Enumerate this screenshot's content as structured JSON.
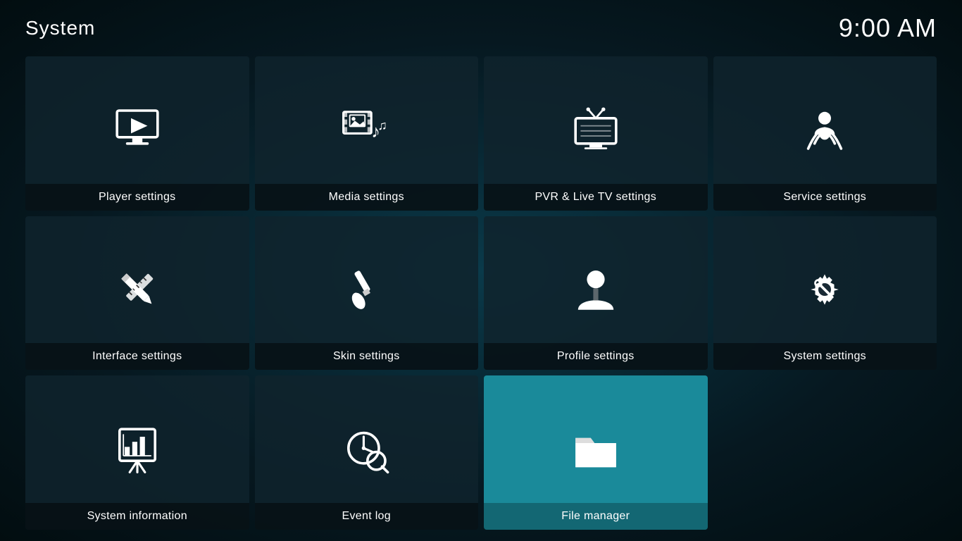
{
  "header": {
    "title": "System",
    "time": "9:00 AM"
  },
  "tiles": [
    {
      "id": "player-settings",
      "label": "Player settings",
      "icon": "player",
      "active": false
    },
    {
      "id": "media-settings",
      "label": "Media settings",
      "icon": "media",
      "active": false
    },
    {
      "id": "pvr-settings",
      "label": "PVR & Live TV settings",
      "icon": "pvr",
      "active": false
    },
    {
      "id": "service-settings",
      "label": "Service settings",
      "icon": "service",
      "active": false
    },
    {
      "id": "interface-settings",
      "label": "Interface settings",
      "icon": "interface",
      "active": false
    },
    {
      "id": "skin-settings",
      "label": "Skin settings",
      "icon": "skin",
      "active": false
    },
    {
      "id": "profile-settings",
      "label": "Profile settings",
      "icon": "profile",
      "active": false
    },
    {
      "id": "system-settings",
      "label": "System settings",
      "icon": "system",
      "active": false
    },
    {
      "id": "system-information",
      "label": "System information",
      "icon": "sysinfo",
      "active": false
    },
    {
      "id": "event-log",
      "label": "Event log",
      "icon": "eventlog",
      "active": false
    },
    {
      "id": "file-manager",
      "label": "File manager",
      "icon": "filemanager",
      "active": true
    }
  ]
}
